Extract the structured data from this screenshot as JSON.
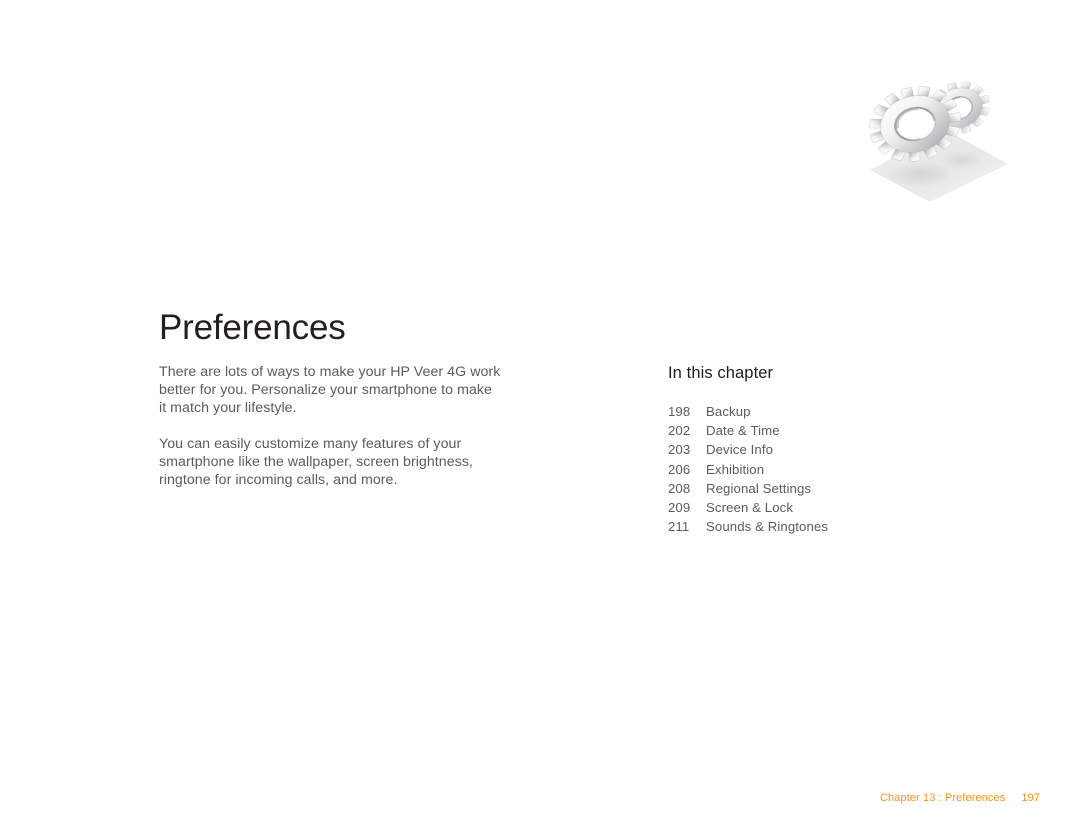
{
  "illustration": {
    "name": "gears-illustration",
    "description": "two interlocking 3d gears on a tilted plane",
    "colors": {
      "gear_light": "#fdfdfd",
      "gear_mid": "#d6d6d8",
      "gear_dark": "#9a9a9d",
      "plane": "#ececed",
      "shadow": "#d8d8da"
    }
  },
  "chapter": {
    "title": "Preferences"
  },
  "intro": {
    "paragraphs": [
      "There are lots of ways to make your HP Veer 4G work better for you. Personalize your smartphone to make it match your lifestyle.",
      "You can easily customize many features of your smartphone like the wallpaper, screen brightness, ringtone for incoming calls, and more."
    ]
  },
  "toc": {
    "heading": "In this chapter",
    "items": [
      {
        "page": "198",
        "label": "Backup"
      },
      {
        "page": "202",
        "label": "Date & Time"
      },
      {
        "page": "203",
        "label": "Device Info"
      },
      {
        "page": "206",
        "label": "Exhibition"
      },
      {
        "page": "208",
        "label": "Regional Settings"
      },
      {
        "page": "209",
        "label": "Screen & Lock"
      },
      {
        "page": "211",
        "label": "Sounds & Ringtones"
      }
    ]
  },
  "footer": {
    "chapter_text": "Chapter 13 : Preferences",
    "page_number": "197",
    "accent_color": "#f7931e"
  }
}
